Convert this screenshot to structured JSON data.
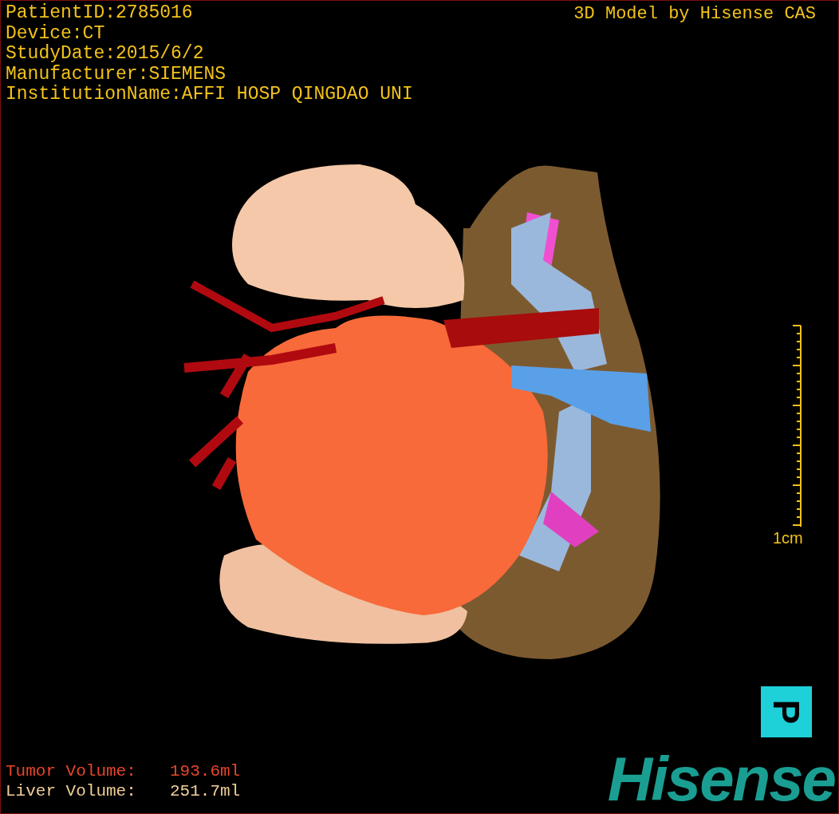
{
  "patient_info": [
    "PatientID:2785016",
    "Device:CT",
    "StudyDate:2015/6/2",
    "Manufacturer:SIEMENS",
    "InstitutionName:AFFI HOSP QINGDAO UNI"
  ],
  "title": "3D Model by Hisense CAS",
  "scale_bar": {
    "label": "1cm"
  },
  "orientation_marker": {
    "label": "P"
  },
  "volumes": [
    {
      "label": "Tumor Volume:",
      "value": "193.6ml",
      "color": "#e8452a"
    },
    {
      "label": "Liver Volume:",
      "value": "251.7ml",
      "color": "#f0cf98"
    }
  ],
  "logo": "Hisense"
}
